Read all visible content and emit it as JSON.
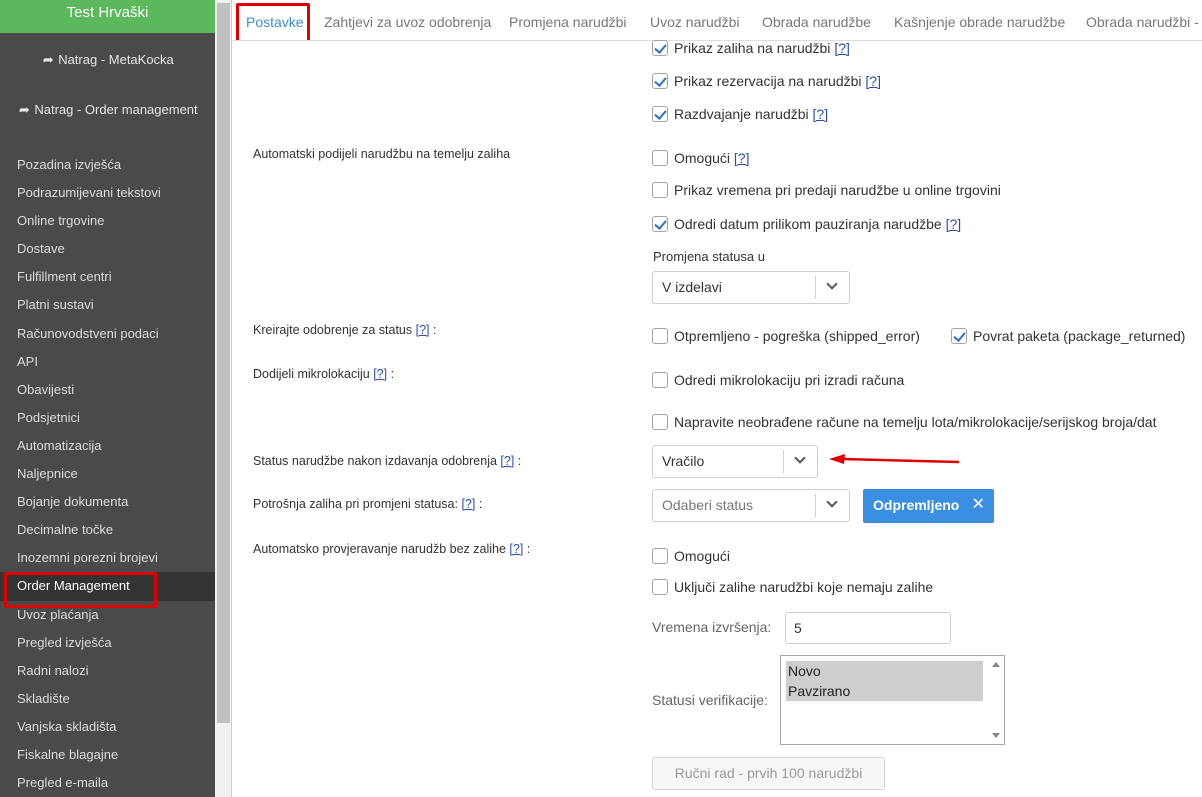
{
  "sidebar": {
    "brand": "Test Hrvaški",
    "back_links": [
      "Natrag - MetaKocka",
      "Natrag - Order management"
    ],
    "items": [
      "Pozadina izvješća",
      "Podrazumijevani tekstovi",
      "Online trgovine",
      "Dostave",
      "Fulfillment centri",
      "Platni sustavi",
      "Računovodstveni podaci",
      "API",
      "Obavijesti",
      "Podsjetnici",
      "Automatizacija",
      "Naljepnice",
      "Bojanje dokumenta",
      "Decimalne točke",
      "Inozemni porezni brojevi",
      "Order Management",
      "Uvoz plaćanja",
      "Pregled izvješća",
      "Radni nalozi",
      "Skladište",
      "Vanjska skladišta",
      "Fiskalne blagajne",
      "Pregled e-maila"
    ],
    "active_item": "Order Management"
  },
  "tabs": [
    "Postavke",
    "Zahtjevi za uvoz odobrenja",
    "Promjena narudžbi",
    "Uvoz narudžbi",
    "Obrada narudžbe",
    "Kašnjenje obrade narudžbe",
    "Obrada narudžbi - a"
  ],
  "active_tab": "Postavke",
  "form": {
    "help": "[?]",
    "top_checks": [
      {
        "label": "Prikaz zaliha na narudžbi",
        "checked": true
      },
      {
        "label": "Prikaz rezervacija na narudžbi",
        "checked": true
      },
      {
        "label": "Razdvajanje narudžbi",
        "checked": true
      }
    ],
    "auto_split": {
      "label": "Automatski podijeli narudžbu na temelju zaliha",
      "enable": "Omogući",
      "show_time": "Prikaz vremena pri predaji narudžbe u online trgovini",
      "set_date": "Odredi datum prilikom pauziranja narudžbe",
      "status_change_label": "Promjena statusa u",
      "status_change_value": "V izdelavi"
    },
    "create_approval": {
      "label": "Kreirajte odobrenje za status",
      "opt1": "Otpremljeno - pogreška (shipped_error)",
      "opt2": "Povrat paketa (package_returned)"
    },
    "microlocation": {
      "label": "Dodijeli mikrolokaciju",
      "opt1": "Odredi mikrolokaciju pri izradi računa",
      "opt2": "Napravite neobrađene račune na temelju lota/mikrolokacije/serijskog broja/dat"
    },
    "status_after": {
      "label": "Status narudžbe nakon izdavanja odobrenja",
      "value": "Vračilo"
    },
    "stock_consumption": {
      "label": "Potrošnja zaliha pri promjeni statusa:",
      "placeholder": "Odaberi status",
      "tag": "Odpremljeno"
    },
    "auto_check": {
      "label": "Automatsko provjeravanje narudžb bez zalihe",
      "enable": "Omogući",
      "include": "Uključi zalihe narudžbi koje nemaju zalihe",
      "exec_times_label": "Vremena izvršenja:",
      "exec_times_value": "5",
      "statuses_label": "Statusi verifikacije:",
      "statuses": [
        "Novo",
        "Pavzirano"
      ],
      "manual_button": "Ručni rad - prvih 100 narudžbi"
    }
  },
  "colors": {
    "sidebar_bg": "#4a4a4a",
    "brand_bg": "#5cb85c",
    "active_tab": "#3a8fd9",
    "tag_bg": "#3a8fe2",
    "highlight": "#e00000"
  }
}
